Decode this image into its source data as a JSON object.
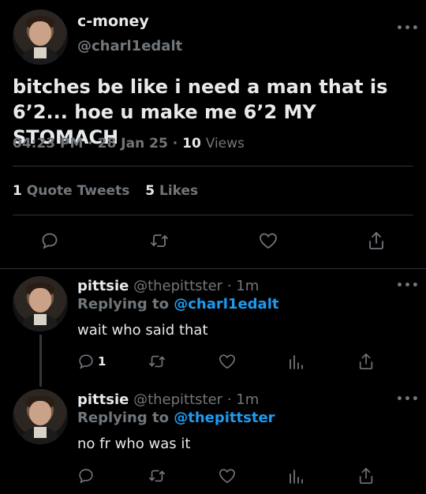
{
  "main_tweet": {
    "display_name": "c-money",
    "handle": "@charl1edalt",
    "text": "bitches be like i need a man that is 6’2... hoe u make me 6’2 MY STOMACH",
    "time": "04:23 PM",
    "date": "28 Jan 25",
    "views_count": "10",
    "views_label": "Views",
    "quote_count": "1",
    "quote_label": "Quote Tweets",
    "likes_count": "5",
    "likes_label": "Likes",
    "more_label": "•••"
  },
  "replies": [
    {
      "display_name": "pittsie",
      "handle": "@thepittster",
      "time": "1m",
      "replying_to_label": "Replying to",
      "replying_to_handle": "@charl1edalt",
      "text": "wait who said that",
      "reply_count": "1",
      "more_label": "•••"
    },
    {
      "display_name": "pittsie",
      "handle": "@thepittster",
      "time": "1m",
      "replying_to_label": "Replying to",
      "replying_to_handle": "@thepittster",
      "text": "no fr who was it",
      "reply_count": "",
      "more_label": "•••"
    }
  ],
  "separators": {
    "dot": "·"
  },
  "icons": {
    "reply": "reply-icon",
    "retweet": "retweet-icon",
    "like": "heart-icon",
    "analytics": "analytics-icon",
    "share": "share-icon",
    "more": "more-icon"
  },
  "colors": {
    "background": "#000000",
    "text": "#e7e9ea",
    "muted": "#71767b",
    "link": "#1d9bf0",
    "divider": "#2f3336"
  }
}
